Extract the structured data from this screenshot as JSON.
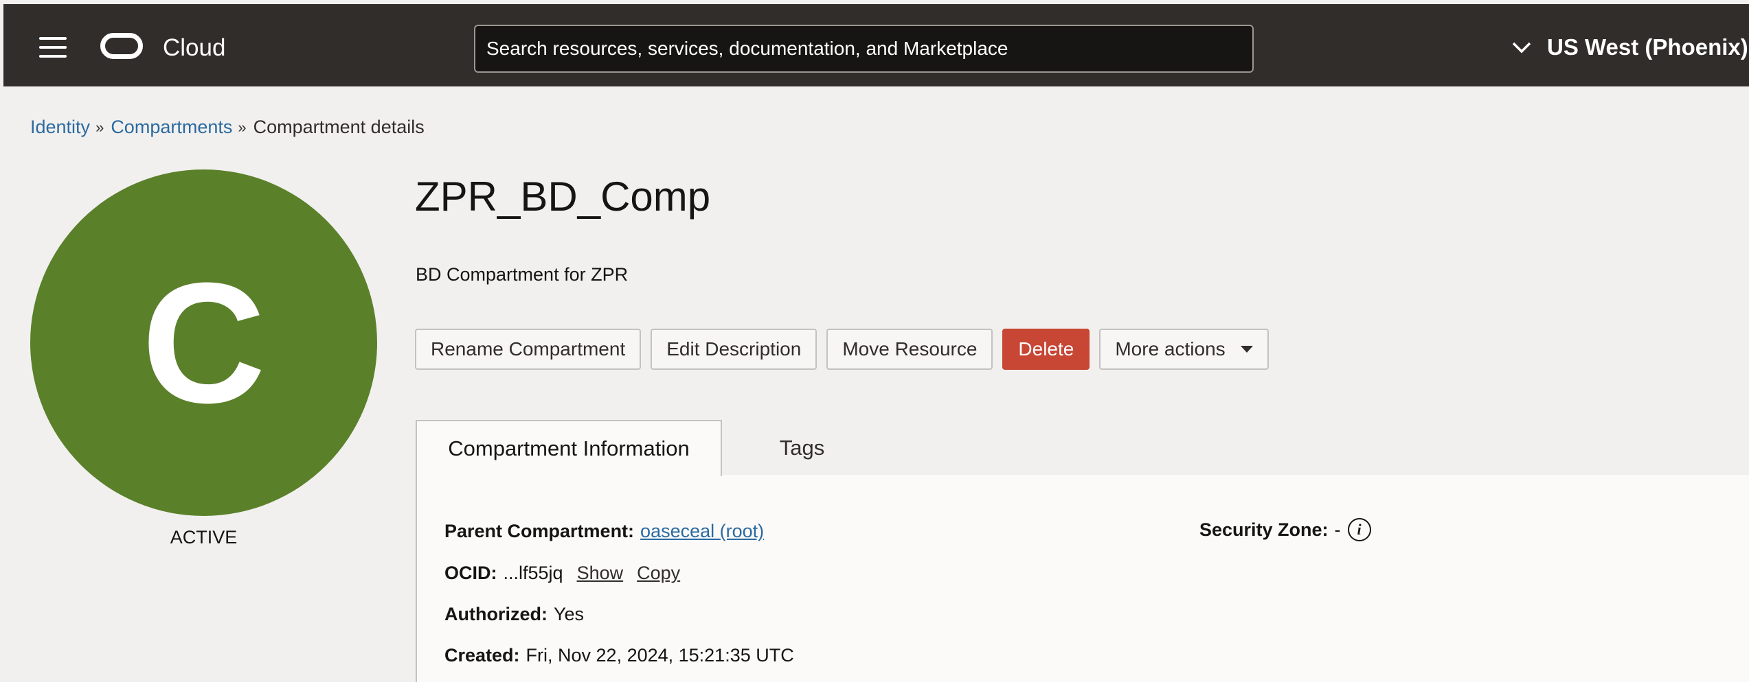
{
  "header": {
    "brand": "Cloud",
    "search_placeholder": "Search resources, services, documentation, and Marketplace",
    "region": "US West (Phoenix)"
  },
  "breadcrumb": [
    {
      "label": "Identity"
    },
    {
      "label": "Compartments"
    },
    {
      "label": "Compartment details"
    }
  ],
  "avatar": {
    "letter": "C",
    "color": "#5b802a",
    "status": "ACTIVE"
  },
  "compartment": {
    "name": "ZPR_BD_Comp",
    "description": "BD Compartment for ZPR"
  },
  "actions": {
    "rename": "Rename Compartment",
    "edit": "Edit Description",
    "move": "Move Resource",
    "delete": "Delete",
    "more": "More actions"
  },
  "tabs": {
    "info": "Compartment Information",
    "tags": "Tags"
  },
  "info": {
    "parent_label": "Parent Compartment:",
    "parent_value": "oaseceal (root)",
    "ocid_label": "OCID:",
    "ocid_value": "...lf55jq",
    "show": "Show",
    "copy": "Copy",
    "authorized_label": "Authorized:",
    "authorized_value": "Yes",
    "created_label": "Created:",
    "created_value": "Fri, Nov 22, 2024, 15:21:35 UTC",
    "security_zone_label": "Security Zone:",
    "security_zone_value": "-"
  }
}
